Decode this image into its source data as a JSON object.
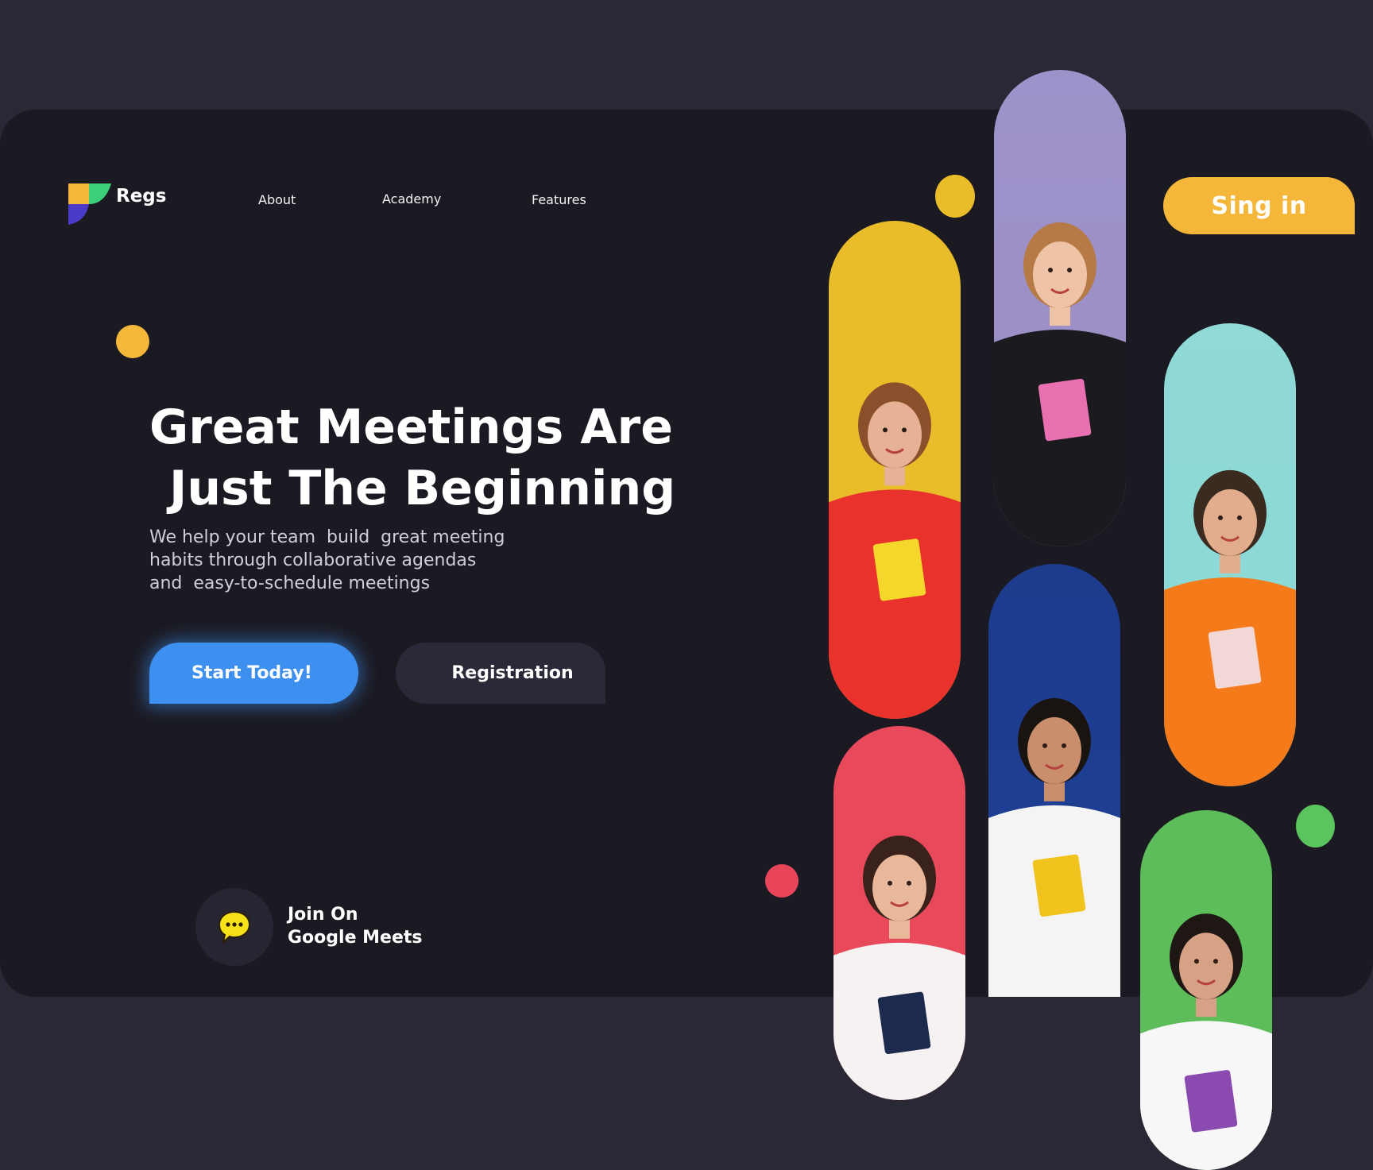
{
  "brand": {
    "name": "Regs"
  },
  "nav": {
    "items": [
      "About",
      "Academy",
      "Features"
    ]
  },
  "header": {
    "signin_label": "Sing in"
  },
  "hero": {
    "title_line1": "Great Meetings Are",
    "title_line2": "Just The Beginning",
    "subtitle_line1": "We help your team  build  great meeting",
    "subtitle_line2": "habits through collaborative agendas",
    "subtitle_line3": "and  easy-to-schedule meetings"
  },
  "buttons": {
    "start": "Start Today!",
    "registration": "Registration"
  },
  "join": {
    "line1": "Join On",
    "line2": "Google Meets",
    "icon": "chat-bubble-icon"
  },
  "colors": {
    "background": "#2a2835",
    "card": "#1b1a22",
    "accent_yellow": "#f4b73a",
    "primary_blue": "#3d8ff0",
    "accent_red": "#e8445a",
    "accent_green": "#5cc45e"
  },
  "gallery": [
    {
      "name": "photo-student-curly-hair-red-hoodie",
      "bg": "#e9bd2a",
      "top": "#e9bd2a",
      "shirt": "#e8322b",
      "hair": "#8a4f2b",
      "skin": "#e6b194",
      "book": "#f5d62b"
    },
    {
      "name": "photo-student-plaid-shirt",
      "bg": "#9b8ec4",
      "top": "#9d92c9",
      "shirt": "#1b1b1f",
      "hair": "#b57a45",
      "skin": "#efc3a6",
      "book": "#e86fb0"
    },
    {
      "name": "photo-student-orange-sweater",
      "bg": "#8ad9d4",
      "top": "#8fd9d7",
      "shirt": "#f57a1a",
      "hair": "#3b2a20",
      "skin": "#e1ad8c",
      "book": "#f2d7d7"
    },
    {
      "name": "photo-student-pink-background",
      "bg": "#e94a5b",
      "top": "#e94a5b",
      "shirt": "#f6f2f2",
      "hair": "#3a221c",
      "skin": "#e9b89b",
      "book": "#1b2a4d"
    },
    {
      "name": "photo-student-blue-background",
      "bg": "#1e3f95",
      "top": "#1d3c8e",
      "shirt": "#f4f4f4",
      "hair": "#1a1411",
      "skin": "#c98f6d",
      "book": "#f1c31d"
    },
    {
      "name": "photo-student-green-background",
      "bg": "#5cbd5a",
      "top": "#5cbd5a",
      "shirt": "#f7f7f7",
      "hair": "#1e1714",
      "skin": "#d6a184",
      "book": "#8a4ab0"
    }
  ]
}
